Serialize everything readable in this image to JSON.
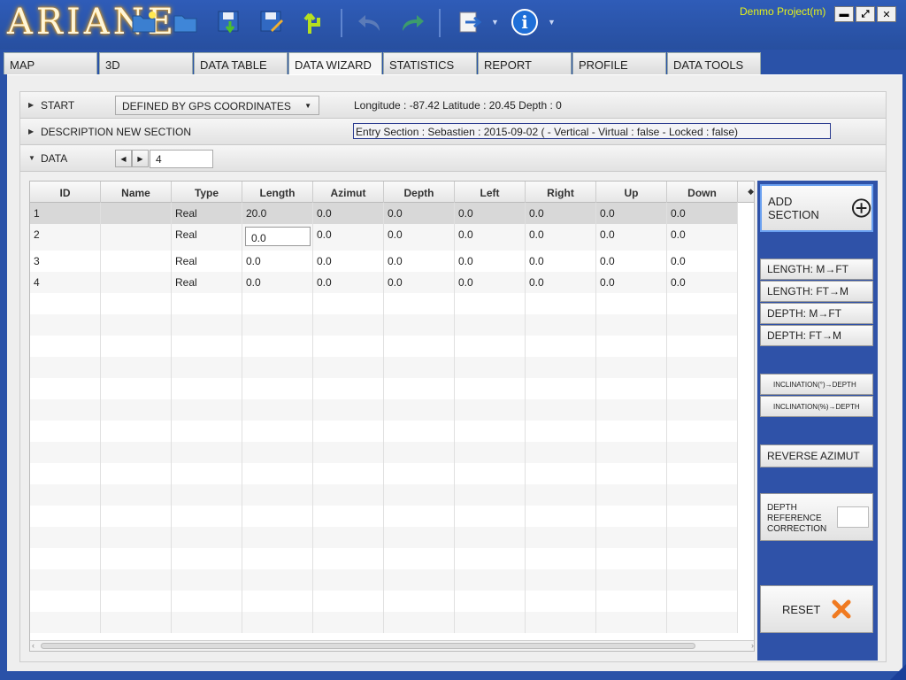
{
  "app": {
    "logo": "ARIANE",
    "project": "Denmo Project(m)"
  },
  "window": {
    "minimize": "▬",
    "maximize": "⤢",
    "close": "✕"
  },
  "tabs": [
    {
      "label": "MAP"
    },
    {
      "label": "3D"
    },
    {
      "label": "DATA TABLE"
    },
    {
      "label": "DATA WIZARD",
      "active": true
    },
    {
      "label": "STATISTICS"
    },
    {
      "label": "REPORT"
    },
    {
      "label": "PROFILE"
    },
    {
      "label": "DATA TOOLS"
    }
  ],
  "start": {
    "label": "START",
    "mode": "DEFINED BY GPS COORDINATES",
    "coords": "Longitude : -87.42 Latitude : 20.45 Depth : 0"
  },
  "description": {
    "label": "DESCRIPTION NEW SECTION",
    "entry": "Entry Section : Sebastien : 2015-09-02  ( - Vertical - Virtual : false - Locked : false)"
  },
  "data": {
    "label": "DATA",
    "count": "4"
  },
  "table": {
    "headers": [
      "ID",
      "Name",
      "Type",
      "Length",
      "Azimut",
      "Depth",
      "Left",
      "Right",
      "Up",
      "Down"
    ],
    "rows": [
      [
        "1",
        "",
        "Real",
        "20.0",
        "0.0",
        "0.0",
        "0.0",
        "0.0",
        "0.0",
        "0.0"
      ],
      [
        "2",
        "",
        "Real",
        "0.0",
        "0.0",
        "0.0",
        "0.0",
        "0.0",
        "0.0",
        "0.0"
      ],
      [
        "3",
        "",
        "Real",
        "0.0",
        "0.0",
        "0.0",
        "0.0",
        "0.0",
        "0.0",
        "0.0"
      ],
      [
        "4",
        "",
        "Real",
        "0.0",
        "0.0",
        "0.0",
        "0.0",
        "0.0",
        "0.0",
        "0.0"
      ]
    ]
  },
  "tools": {
    "add_section": "ADD SECTION",
    "length_m_ft": "LENGTH: M→FT",
    "length_ft_m": "LENGTH: FT→M",
    "depth_m_ft": "DEPTH: M→FT",
    "depth_ft_m": "DEPTH: FT→M",
    "incl_deg": "INCLINATION(°)→DEPTH",
    "incl_pct": "INCLINATION(%)→DEPTH",
    "reverse_azimut": "REVERSE AZIMUT",
    "depth_ref_1": "DEPTH",
    "depth_ref_2": "REFERENCE",
    "depth_ref_3": "CORRECTION",
    "reset": "RESET"
  },
  "colors": {
    "frame": "#2a52a8",
    "accent": "#e6f21a",
    "reset_x": "#f07a20"
  }
}
